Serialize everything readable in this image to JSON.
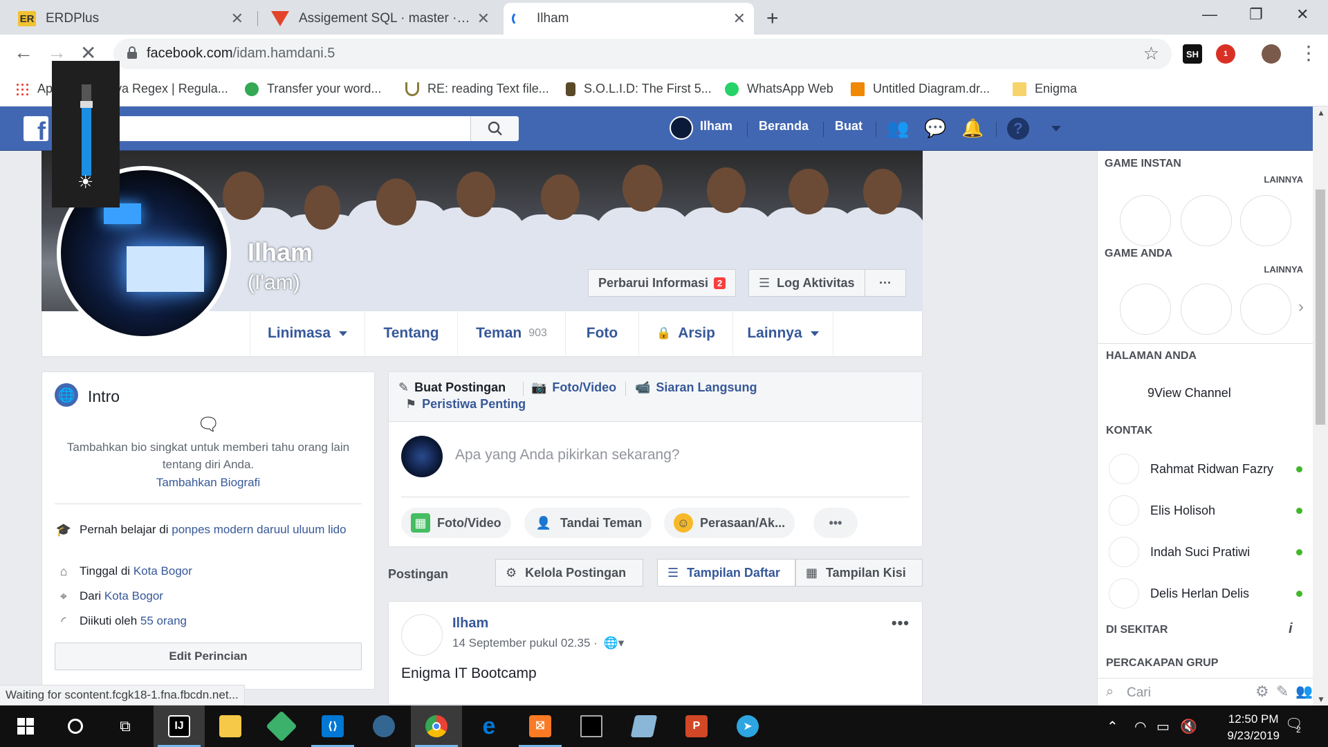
{
  "browser": {
    "tabs": [
      {
        "title": "ERDPlus",
        "favicon": "er-icon"
      },
      {
        "title": "Assigement SQL · master · Enigma",
        "favicon": "gitlab-icon"
      },
      {
        "title": "Ilham",
        "favicon": "loading-icon"
      }
    ],
    "url_host": "facebook.com",
    "url_path": "/idam.hamdani.5",
    "extensions": [
      "SH",
      "1"
    ],
    "bookmarks": [
      {
        "label": "Ap",
        "icon": "apps-icon"
      },
      {
        "label": "Java Regex | Regula...",
        "icon": "java-icon"
      },
      {
        "label": "Transfer your word...",
        "icon": "green-icon"
      },
      {
        "label": "RE: reading Text file...",
        "icon": "u-icon"
      },
      {
        "label": "S.O.L.I.D: The First 5...",
        "icon": "bottle-icon"
      },
      {
        "label": "WhatsApp Web",
        "icon": "whatsapp-icon"
      },
      {
        "label": "Untitled Diagram.dr...",
        "icon": "drawio-icon"
      },
      {
        "label": "Enigma",
        "icon": "folder-icon"
      }
    ],
    "brightness_level": 0.74,
    "status_text": "Waiting for scontent.fcgk18-1.fna.fbcdn.net..."
  },
  "fb": {
    "search_value": "Ilham",
    "nav_user": "Ilham",
    "nav_home": "Beranda",
    "nav_create": "Buat"
  },
  "profile": {
    "name": "Ilham",
    "alt_name": "(I'am)",
    "update_info": "Perbarui Informasi",
    "update_badge": "2",
    "activity_log": "Log Aktivitas",
    "more_dots": "···",
    "tabs": [
      {
        "label": "Linimasa"
      },
      {
        "label": "Tentang"
      },
      {
        "label": "Teman",
        "count": "903"
      },
      {
        "label": "Foto"
      },
      {
        "label": "Arsip"
      },
      {
        "label": "Lainnya"
      }
    ]
  },
  "intro": {
    "title": "Intro",
    "bio_prompt": "Tambahkan bio singkat untuk memberi tahu orang lain tentang diri Anda.",
    "add_bio": "Tambahkan Biografi",
    "studied_prefix": "Pernah belajar di",
    "studied_place": "ponpes modern daruul uluum lido",
    "lives_prefix": "Tinggal di",
    "lives_place": "Kota Bogor",
    "from_prefix": "Dari",
    "from_place": "Kota Bogor",
    "followed_prefix": "Diikuti oleh",
    "followed_count": "55 orang",
    "edit_button": "Edit Perincian"
  },
  "composer": {
    "tab_create": "Buat Postingan",
    "tab_photo": "Foto/Video",
    "tab_live": "Siaran Langsung",
    "tab_event": "Peristiwa Penting",
    "placeholder": "Apa yang Anda pikirkan sekarang?",
    "btn_photo": "Foto/Video",
    "btn_tag": "Tandai Teman",
    "btn_feeling": "Perasaan/Ak...",
    "btn_more": "•••"
  },
  "posts_bar": {
    "label": "Postingan",
    "manage": "Kelola Postingan",
    "list_view": "Tampilan Daftar",
    "grid_view": "Tampilan Kisi"
  },
  "post": {
    "author": "Ilham",
    "time": "14 September pukul 02.35 ·",
    "text": "Enigma IT Bootcamp",
    "more": "•••"
  },
  "sidebar": {
    "instant_games": "GAME INSTAN",
    "your_games": "GAME ANDA",
    "more": "LAINNYA",
    "your_pages": "HALAMAN ANDA",
    "page_name": "9View Channel",
    "contacts": "KONTAK",
    "contact_list": [
      {
        "name": "Rahmat Ridwan Fazry"
      },
      {
        "name": "Elis Holisoh"
      },
      {
        "name": "Indah Suci Pratiwi"
      },
      {
        "name": "Delis Herlan Delis"
      }
    ],
    "nearby": "DI SEKITAR",
    "group_chats": "PERCAKAPAN GRUP",
    "search_placeholder": "Cari"
  },
  "taskbar": {
    "time": "12:50 PM",
    "date": "9/23/2019",
    "notifications": "2"
  },
  "colors": {
    "fb_blue": "#4267b2",
    "link": "#365899",
    "online": "#42b72a",
    "badge_red": "#fa3e3e"
  }
}
